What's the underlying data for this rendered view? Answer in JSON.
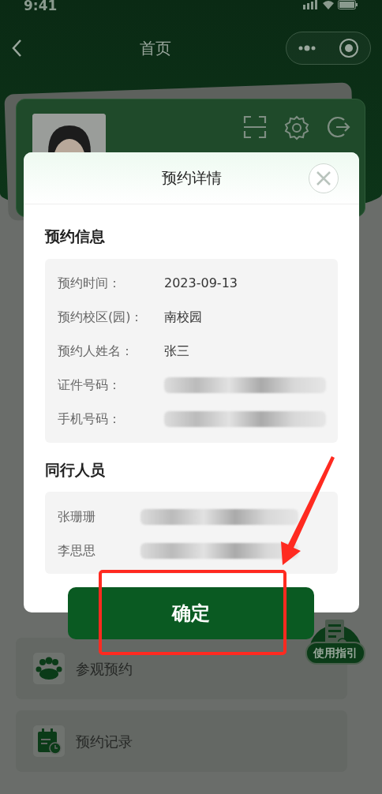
{
  "status_bar": {
    "time": "9:41"
  },
  "header": {
    "title": "首页"
  },
  "menu": [
    {
      "label": "参观预约"
    },
    {
      "label": "预约记录"
    }
  ],
  "guide_button": {
    "label": "使用指引"
  },
  "dialog": {
    "title": "预约详情",
    "sections": [
      {
        "title": "预约信息",
        "rows": [
          {
            "label": "预约时间：",
            "value": "2023-09-13"
          },
          {
            "label": "预约校区(园)：",
            "value": "南校园"
          },
          {
            "label": "预约人姓名：",
            "value": "张三"
          },
          {
            "label": "证件号码：",
            "redacted": true
          },
          {
            "label": "手机号码：",
            "redacted": true
          }
        ]
      },
      {
        "title": "同行人员",
        "rows": [
          {
            "label": "张珊珊",
            "redacted": true
          },
          {
            "label": "李思思",
            "redacted": true
          }
        ]
      }
    ],
    "confirm": "确定"
  }
}
